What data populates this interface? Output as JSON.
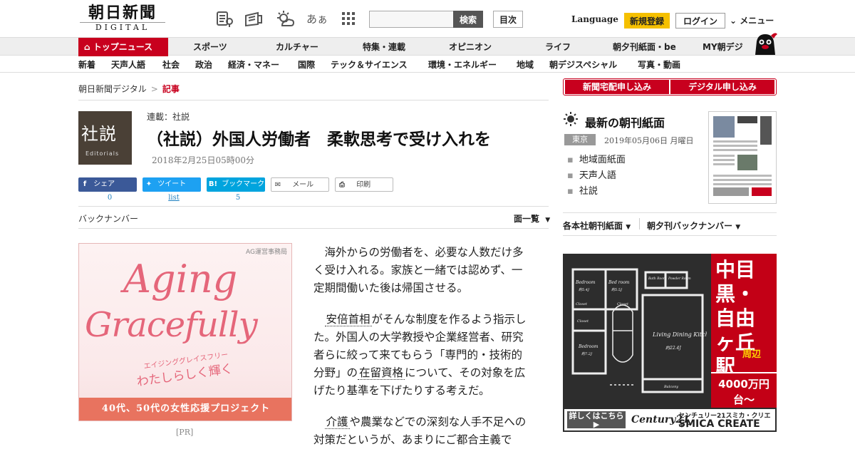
{
  "header": {
    "logo_kanji": "朝日新聞",
    "logo_sub": "DIGITAL",
    "search_button": "検索",
    "toc_button": "目次",
    "language": "Language",
    "signup": "新規登録",
    "login": "ログイン",
    "menu": "メニュー",
    "kana_icon_text": "あぁ",
    "colors": {
      "brand_red": "#c8001e",
      "signup_yellow": "#f5c000"
    }
  },
  "nav_primary": [
    "トップニュース",
    "スポーツ",
    "カルチャー",
    "特集・連載",
    "オピニオン",
    "ライフ",
    "朝夕刊紙面・be",
    "MY朝デジ"
  ],
  "nav_secondary": [
    "新着",
    "天声人語",
    "社会",
    "政治",
    "経済・マネー",
    "国際",
    "テック＆サイエンス",
    "環境・エネルギー",
    "地域",
    "朝デジスペシャル",
    "写真・動画"
  ],
  "breadcrumb": {
    "home": "朝日新聞デジタル",
    "sep": ">",
    "current": "記事"
  },
  "article": {
    "logo_kanji": "社説",
    "logo_en": "Editorials",
    "series": "連載：社説",
    "title": "（社説）外国人労働者　柔軟思考で受け入れを",
    "date": "2018年2月25日05時00分",
    "paragraphs": [
      {
        "text": "海外からの労働者を、必要な人数だけ多く受け入れる。家族と一緒では認めず、一定期間働いた後は帰国させる。"
      },
      {
        "kw1": "安倍首相",
        "t1": "がそんな制度を作るよう指示した。外国人の大学教授や企業経営者、研究者らに絞って来てもらう「専門的・技術的分野」の",
        "kw2": "在留資格",
        "t2": "について、その対象を広げたり基準を下げたりする考えだ。"
      },
      {
        "kw1": "介護",
        "t1": "や農業などでの深刻な人手不足への対策だというが、あまりにご都合主義で"
      }
    ]
  },
  "share": {
    "facebook": {
      "label": "シェア",
      "count": "0"
    },
    "twitter": {
      "label": "ツイート",
      "count": "list"
    },
    "hatena": {
      "label": "ブックマーク",
      "count": "5",
      "icon": "B!"
    },
    "mail": {
      "label": "メール"
    },
    "print": {
      "label": "印刷"
    }
  },
  "backnumber": {
    "label": "バックナンバー",
    "page_list": "面一覧"
  },
  "ad_left": {
    "sponsor": "AG運営事務局",
    "script_line1": "Aging",
    "script_line2": "Gracefully",
    "kana": "エイジンググレイスフリー",
    "tagline": "わたしらしく輝く",
    "banner": "40代、50代の女性応援プロジェクト",
    "pr_label": "[PR]"
  },
  "sidebar": {
    "subscribe_home": "新聞宅配申し込み",
    "subscribe_digital": "デジタル申し込み",
    "latest_title": "最新の朝刊紙面",
    "edition": "東京",
    "edition_date": "2019年05月06日 月曜日",
    "links": [
      "地域面紙面",
      "天声人語",
      "社説"
    ],
    "menu_1": "各本社朝刊紙面",
    "menu_2": "朝夕刊バックナンバー"
  },
  "ad_right": {
    "place_line1": "中目黒・",
    "place_line2": "自由ヶ丘駅",
    "area": "周辺",
    "price": "4000万円台〜",
    "detail_button": "詳しくはこちら",
    "brand": "Century21",
    "company_jp": "センチュリー21スミカ・クリエイト",
    "company_en": "SMICA CREATE",
    "rooms": [
      "Bedroom",
      "Bed room",
      "Bath Room",
      "Powder Room",
      "Closet",
      "Closet",
      "Closet",
      "Living Dining Kitchen",
      "Bedroom",
      "Balcony"
    ],
    "room_sizes": [
      "約5.4J",
      "約5.5J",
      "約7.2J",
      "約22.4J"
    ]
  }
}
